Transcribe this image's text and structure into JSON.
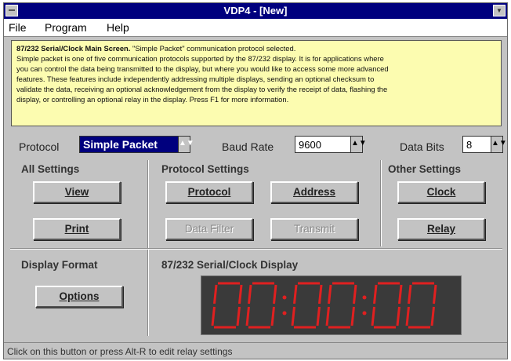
{
  "window": {
    "title": "VDP4 - [New]"
  },
  "menu": {
    "file": "File",
    "program": "Program",
    "help": "Help"
  },
  "info": {
    "heading": "87/232 Serial/Clock Main Screen.",
    "heading_rest": " \"Simple Packet\" communication protocol selected.",
    "lines": [
      "Simple packet is one of five communication protocols supported by the 87/232 display. It is for applications where",
      "you can control the data being transmitted to the display, but where you would like to access some more advanced",
      "features. These features include independently addressing multiple displays, sending an optional checksum to",
      "validate the data, receiving an optional acknowledgement from the display to verify the receipt of data, flashing the",
      "display, or controlling an optional relay in the display. Press F1 for more information."
    ]
  },
  "protocol": {
    "label": "Protocol",
    "value": "Simple Packet"
  },
  "baud": {
    "label": "Baud Rate",
    "value": "9600"
  },
  "databits": {
    "label": "Data Bits",
    "value": "8"
  },
  "groups": {
    "all_settings": "All Settings",
    "protocol_settings": "Protocol Settings",
    "other_settings": "Other Settings",
    "display_format": "Display Format",
    "serial_display": "87/232 Serial/Clock Display"
  },
  "buttons": {
    "view": "View",
    "print": "Print",
    "protocol": "Protocol",
    "address": "Address",
    "data_filter": "Data Filter",
    "transmit": "Transmit",
    "clock": "Clock",
    "relay": "Relay",
    "options": "Options"
  },
  "display": {
    "text": "00:00:00",
    "color": "#e02020"
  },
  "status": "Click on this button or press Alt-R to edit relay settings"
}
